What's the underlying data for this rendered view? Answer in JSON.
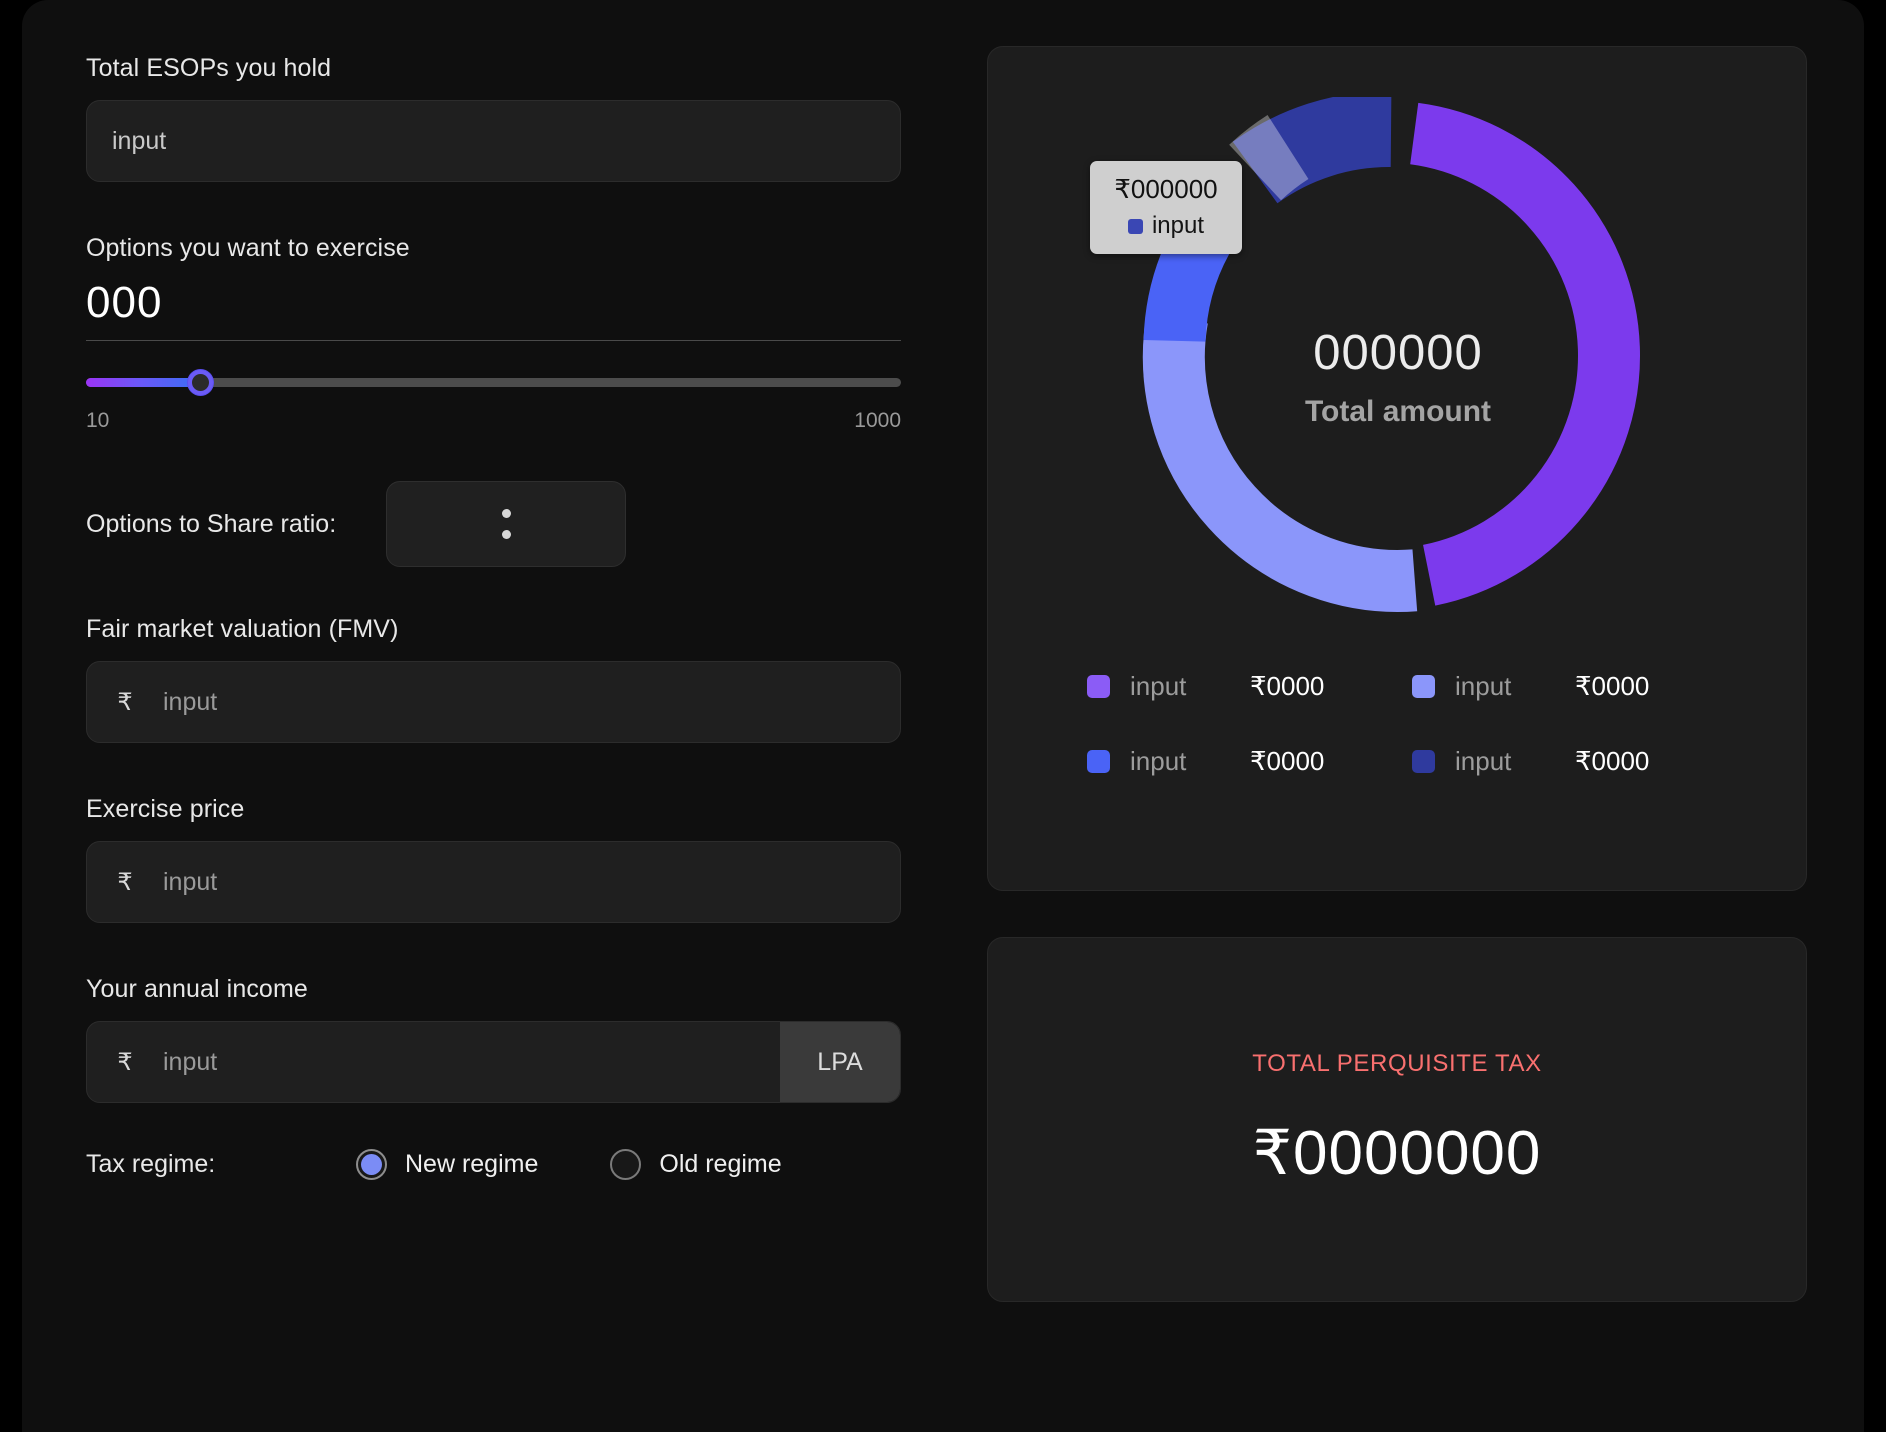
{
  "form": {
    "esops": {
      "label": "Total ESOPs you hold",
      "placeholder": "input"
    },
    "exercise": {
      "label": "Options you want to exercise",
      "value": "000",
      "slider_min_label": "10",
      "slider_max_label": "1000",
      "slider_percent": 14
    },
    "ratio": {
      "label": "Options to Share ratio:",
      "value": ":"
    },
    "fmv": {
      "label": "Fair market valuation (FMV)",
      "currency_symbol": "₹",
      "placeholder": "input"
    },
    "exercise_price": {
      "label": "Exercise price",
      "currency_symbol": "₹",
      "placeholder": "input"
    },
    "annual_income": {
      "label": "Your annual income",
      "currency_symbol": "₹",
      "placeholder": "input",
      "suffix": "LPA"
    },
    "tax_regime": {
      "label": "Tax regime:",
      "options": [
        {
          "label": "New regime",
          "selected": true
        },
        {
          "label": "Old regime",
          "selected": false
        }
      ]
    }
  },
  "chart_panel": {
    "center_amount": "000000",
    "center_caption": "Total amount",
    "tooltip": {
      "amount": "₹000000",
      "series_label": "input",
      "swatch_color": "#3a47b4"
    }
  },
  "chart_data": {
    "type": "pie",
    "variant": "donut",
    "title": "Total amount",
    "center_value_label": "000000",
    "legend_position": "bottom",
    "categories": [
      "input",
      "input",
      "input",
      "input"
    ],
    "values": [
      47,
      24,
      13,
      16
    ],
    "value_labels": [
      "₹0000",
      "₹0000",
      "₹0000",
      "₹0000"
    ],
    "colors": [
      "#7c3aed",
      "#8b96fa",
      "#4a63f6",
      "#2f3a9e"
    ],
    "hovered_index": 3,
    "hover_tooltip": "₹000000"
  },
  "legend": [
    {
      "name": "input",
      "value": "₹0000",
      "color": "#8b5cf6"
    },
    {
      "name": "input",
      "value": "₹0000",
      "color": "#8b96fa"
    },
    {
      "name": "input",
      "value": "₹0000",
      "color": "#4a63f6"
    },
    {
      "name": "input",
      "value": "₹0000",
      "color": "#2f3a9e"
    }
  ],
  "tax_panel": {
    "title": "TOTAL PERQUISITE TAX",
    "amount": "₹0000000",
    "title_color": "#f9706f"
  }
}
